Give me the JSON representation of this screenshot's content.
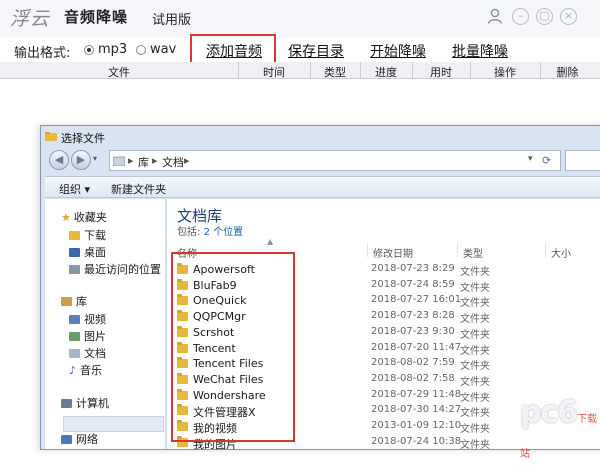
{
  "app": {
    "logo": "浮云",
    "name": "音频降噪",
    "edition": "试用版"
  },
  "toolbar": {
    "format_label": "输出格式:",
    "format_options": [
      "mp3",
      "wav"
    ],
    "format_selected": "mp3",
    "buttons": [
      "添加音频",
      "保存目录",
      "开始降噪",
      "批量降噪"
    ]
  },
  "table": {
    "columns": [
      "文件",
      "时间",
      "类型",
      "进度",
      "用时",
      "操作",
      "删除"
    ]
  },
  "dialog": {
    "title": "选择文件",
    "address": [
      "库",
      "文档"
    ],
    "commands": [
      "组织 ▾",
      "新建文件夹"
    ],
    "nav": {
      "favorites": "收藏夹",
      "fav_items": [
        "下载",
        "桌面",
        "最近访问的位置"
      ],
      "library": "库",
      "lib_items": [
        "视频",
        "图片",
        "文档",
        "音乐"
      ],
      "computer": "计算机",
      "network": "网络"
    },
    "library_title": "文档库",
    "library_sub_prefix": "包括:",
    "library_sub_link": "2 个位置",
    "columns": [
      "名称",
      "修改日期",
      "类型",
      "大小"
    ],
    "files": [
      {
        "name": "Apowersoft",
        "date": "2018-07-23 8:29",
        "type": "文件夹"
      },
      {
        "name": "BluFab9",
        "date": "2018-07-24 8:59",
        "type": "文件夹"
      },
      {
        "name": "OneQuick",
        "date": "2018-07-27 16:01",
        "type": "文件夹"
      },
      {
        "name": "QQPCMgr",
        "date": "2018-07-23 8:28",
        "type": "文件夹"
      },
      {
        "name": "Scrshot",
        "date": "2018-07-23 9:30",
        "type": "文件夹"
      },
      {
        "name": "Tencent",
        "date": "2018-07-20 11:47",
        "type": "文件夹"
      },
      {
        "name": "Tencent Files",
        "date": "2018-08-02 7:59",
        "type": "文件夹"
      },
      {
        "name": "WeChat Files",
        "date": "2018-08-02 7:58",
        "type": "文件夹"
      },
      {
        "name": "Wondershare",
        "date": "2018-07-29 11:48",
        "type": "文件夹"
      },
      {
        "name": "文件管理器X",
        "date": "2018-07-30 14:27",
        "type": "文件夹"
      },
      {
        "name": "我的视频",
        "date": "2013-01-09 12:10",
        "type": "文件夹"
      },
      {
        "name": "我的图片",
        "date": "2018-07-24 10:38",
        "type": "文件夹"
      }
    ]
  },
  "watermark": {
    "logo": "pc6",
    "sub": "下载站"
  },
  "colors": {
    "highlight": "#d43a32",
    "folder": "#e7b83c",
    "link": "#1e5eb0"
  }
}
